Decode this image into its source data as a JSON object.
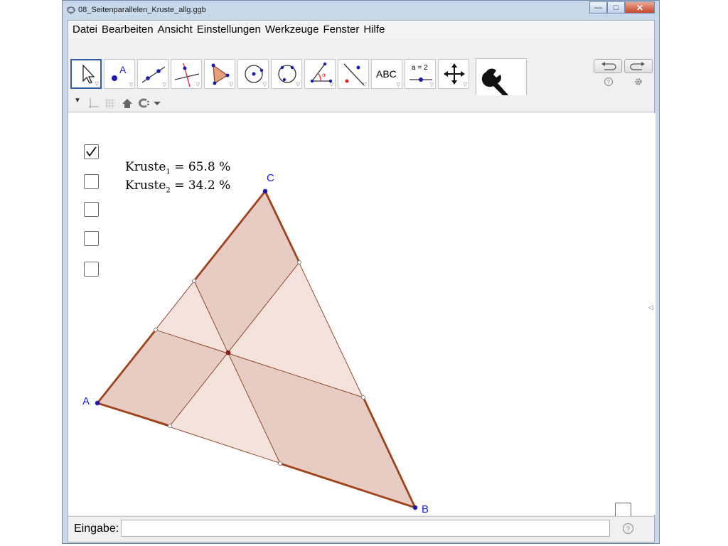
{
  "window": {
    "title": "08_Seitenparallelen_Kruste_allg.ggb"
  },
  "menu": [
    "Datei",
    "Bearbeiten",
    "Ansicht",
    "Einstellungen",
    "Werkzeuge",
    "Fenster",
    "Hilfe"
  ],
  "toolbar": {
    "tools": [
      "move-tool",
      "point-tool",
      "line-tool",
      "perpendicular-tool",
      "polygon-tool",
      "circle-center-tool",
      "circle-three-points-tool",
      "angle-tool",
      "reflect-tool",
      "text-tool",
      "slider-tool",
      "move-view-tool"
    ],
    "point_tool_label": "A",
    "text_tool_label": "ABC",
    "slider_tool_label": "a = 2"
  },
  "graphics": {
    "kruste1": {
      "name": "Kruste",
      "index": "1",
      "value": "= 65.8 %"
    },
    "kruste2": {
      "name": "Kruste",
      "index": "2",
      "value": "= 34.2 %"
    },
    "point_labels": {
      "A": "A",
      "B": "B",
      "C": "C"
    },
    "checkboxes": [
      true,
      false,
      false,
      false,
      false,
      false
    ]
  },
  "input_bar": {
    "label": "Eingabe:",
    "value": ""
  },
  "colors": {
    "fill": "#d9aea0",
    "edge": "#a0421a",
    "point": "#1a1ab0",
    "label": "#1a1ae0"
  }
}
